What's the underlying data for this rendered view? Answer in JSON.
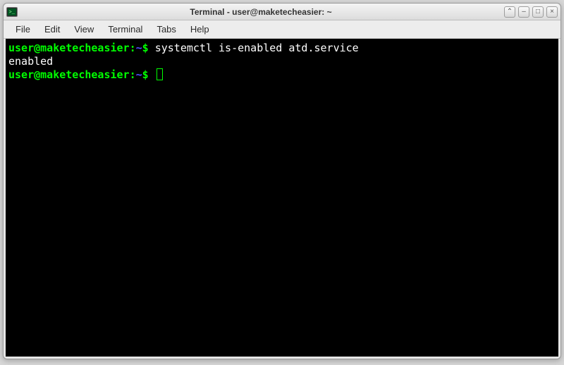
{
  "titlebar": {
    "title": "Terminal - user@maketecheasier: ~",
    "icon": "terminal-icon",
    "btn_up": "⌃",
    "btn_min": "–",
    "btn_max": "□",
    "btn_close": "×"
  },
  "menubar": {
    "items": [
      "File",
      "Edit",
      "View",
      "Terminal",
      "Tabs",
      "Help"
    ]
  },
  "terminal": {
    "prompt_userhost": "user@maketecheasier",
    "prompt_sep": ":",
    "prompt_path": "~",
    "prompt_symbol": "$",
    "lines": [
      {
        "type": "cmd",
        "command": "systemctl is-enabled atd.service"
      },
      {
        "type": "out",
        "text": "enabled"
      },
      {
        "type": "cmd",
        "command": "",
        "cursor": true
      }
    ]
  }
}
